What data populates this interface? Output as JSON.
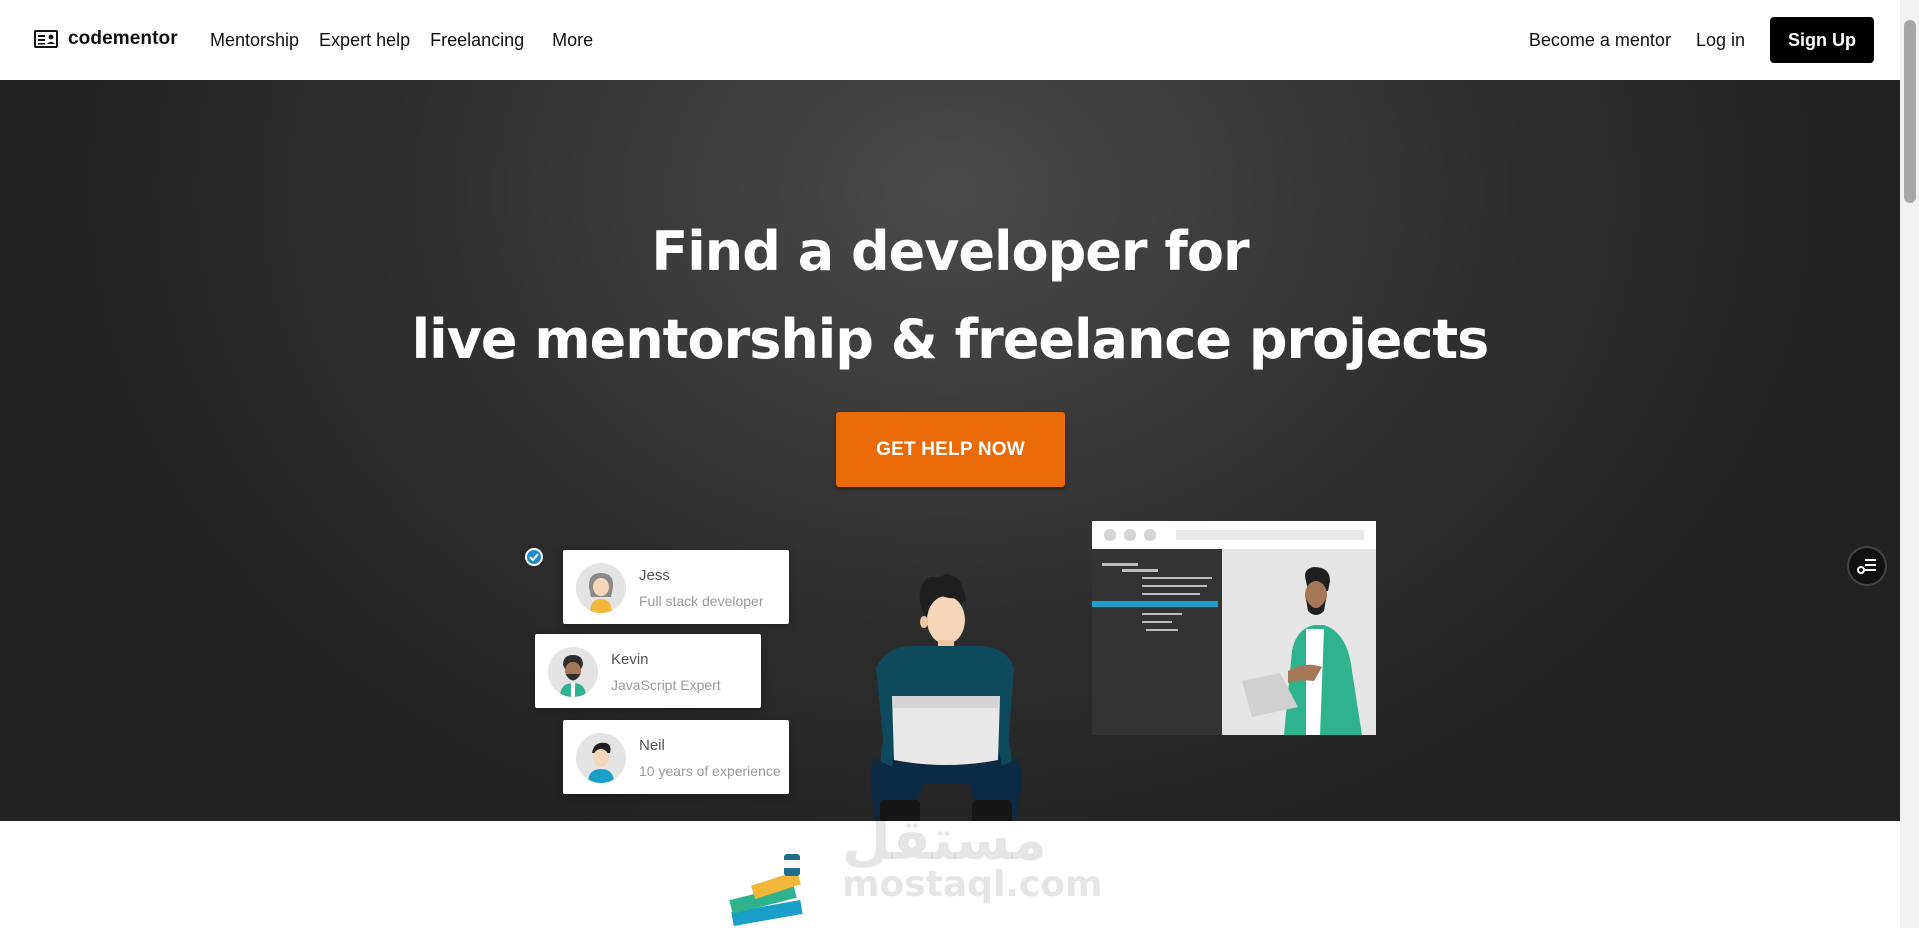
{
  "brand": {
    "name": "codementor"
  },
  "nav": {
    "left_links": [
      "Mentorship",
      "Expert help",
      "Freelancing",
      "More"
    ],
    "become_mentor": "Become a mentor",
    "login": "Log in",
    "signup": "Sign Up"
  },
  "hero": {
    "title_line1": "Find a developer for",
    "title_line2": "live mentorship & freelance projects",
    "cta": "GET HELP NOW",
    "accent_color": "#e96a06"
  },
  "profiles": [
    {
      "name": "Jess",
      "role": "Full stack developer"
    },
    {
      "name": "Kevin",
      "role": "JavaScript Expert"
    },
    {
      "name": "Neil",
      "role": "10 years of experience"
    }
  ],
  "watermark": {
    "arabic": "مستقل",
    "latin": "mostaql.com"
  }
}
